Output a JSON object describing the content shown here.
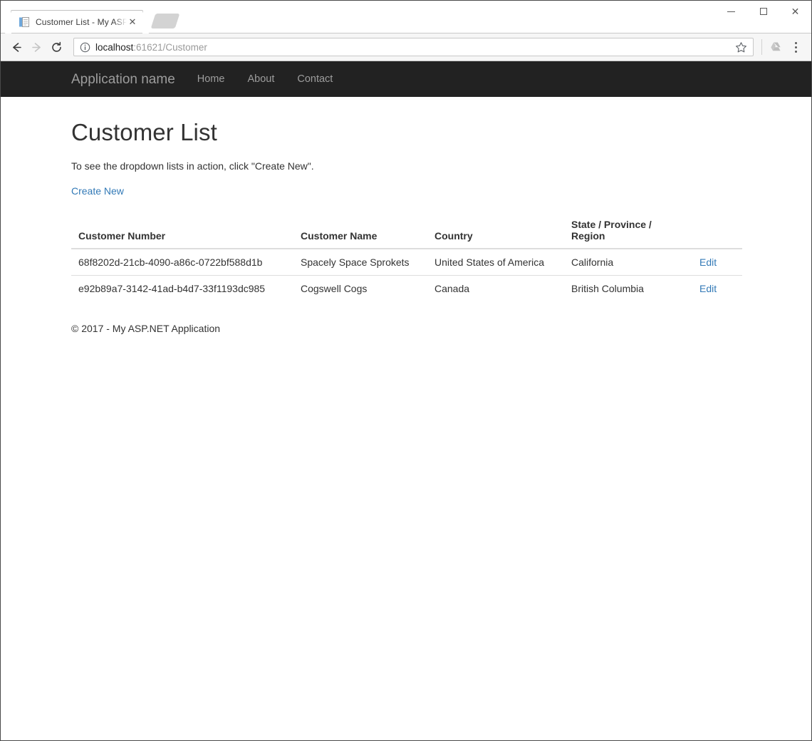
{
  "browser": {
    "tab": {
      "title": "Customer List - My ASP.N",
      "favicon_name": "document-favicon",
      "close_label": "✕"
    },
    "new_tab_label": "",
    "window_controls": {
      "minimize": "–",
      "maximize": "☐",
      "close": "✕"
    },
    "toolbar": {
      "back_label": "Back",
      "forward_label": "Forward",
      "reload_label": "Reload",
      "url_host": "localhost",
      "url_rest": ":61621/Customer",
      "url_full": "localhost:61621/Customer",
      "star_label": "Bookmark this page",
      "drive_label": "Save to Google Drive",
      "menu_label": "Customize and control Google Chrome"
    }
  },
  "site": {
    "navbar": {
      "brand": "Application name",
      "links": [
        {
          "label": "Home"
        },
        {
          "label": "About"
        },
        {
          "label": "Contact"
        }
      ]
    },
    "main": {
      "title": "Customer List",
      "description": "To see the dropdown lists in action, click \"Create New\".",
      "create_new_label": "Create New",
      "table": {
        "headers": [
          "Customer Number",
          "Customer Name",
          "Country",
          "State / Province / Region",
          ""
        ],
        "rows": [
          {
            "number": "68f8202d-21cb-4090-a86c-0722bf588d1b",
            "name": "Spacely Space Sprokets",
            "country": "United States of America",
            "region": "California",
            "edit_label": "Edit"
          },
          {
            "number": "e92b89a7-3142-41ad-b4d7-33f1193dc985",
            "name": "Cogswell Cogs",
            "country": "Canada",
            "region": "British Columbia",
            "edit_label": "Edit"
          }
        ]
      }
    },
    "footer": {
      "copyright": "© 2017 - My ASP.NET Application"
    }
  },
  "colors": {
    "navbar_bg": "#222222",
    "navbar_text": "#9d9d9d",
    "link": "#337ab7",
    "body_text": "#333333",
    "table_border": "#dddddd"
  }
}
